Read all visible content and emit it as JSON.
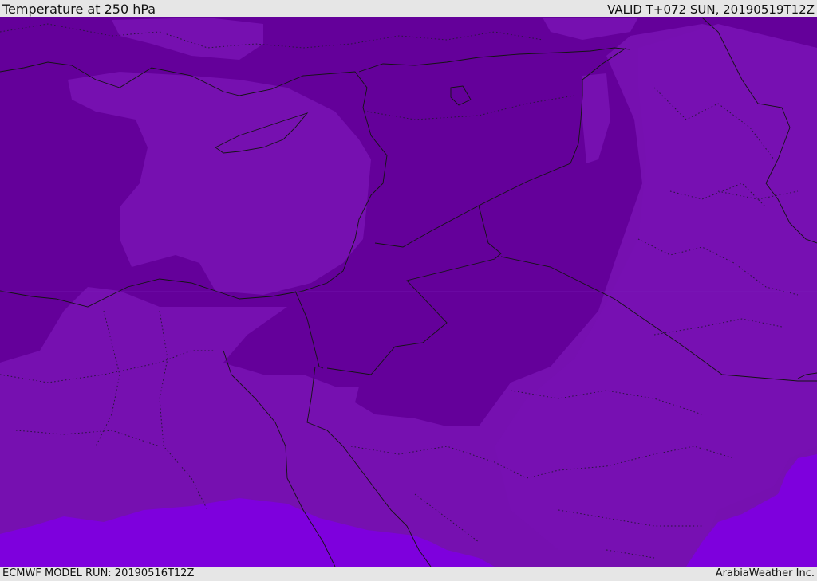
{
  "header": {
    "title": "Temperature at 250 hPa",
    "valid": "VALID T+072 SUN, 20190519T12Z"
  },
  "footer": {
    "model_run": "ECMWF MODEL RUN: 20190516T12Z",
    "credit": "ArabiaWeather Inc."
  },
  "colors": {
    "coldest_band": "#64009a",
    "cold_band": "#7610b0",
    "mid_band": "#7510b4",
    "warm_band": "#7e00dd",
    "frame": "#e6e6e6"
  },
  "map": {
    "field": "temperature",
    "level": "250 hPa",
    "coastlines": true,
    "country_borders": true,
    "province_borders": "dotted"
  }
}
